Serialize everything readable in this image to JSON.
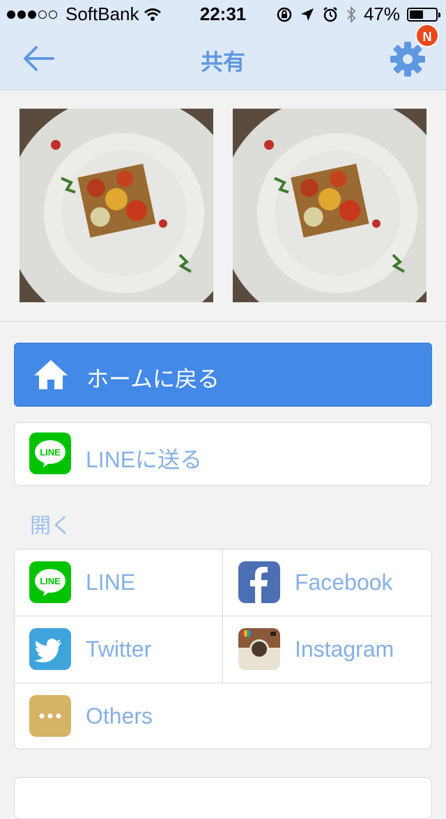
{
  "status_bar": {
    "carrier": "SoftBank",
    "time": "22:31",
    "battery": "47%",
    "battery_level": 0.47
  },
  "nav": {
    "title": "共有",
    "badge": "N",
    "icons": [
      "back-arrow-icon",
      "gear-icon"
    ]
  },
  "photos": [
    "food-plate-photo",
    "food-plate-photo"
  ],
  "home_button": {
    "label": "ホームに戻る",
    "icon": "house-icon"
  },
  "line_send": {
    "label": "LINEに送る",
    "icon_text": "LINE"
  },
  "open_section": {
    "title": "開く"
  },
  "share_grid": [
    {
      "label": "LINE",
      "icon_text": "LINE",
      "icon": "line-icon"
    },
    {
      "label": "Facebook",
      "icon": "facebook-icon"
    },
    {
      "label": "Twitter",
      "icon": "twitter-icon"
    },
    {
      "label": "Instagram",
      "icon": "instagram-icon"
    },
    {
      "label": "Others",
      "icon": "more-dots-icon"
    }
  ],
  "colors": {
    "nav_bg": "#dde9f7",
    "accent": "#4289e8",
    "label": "#85b0e6",
    "line_green": "#00c300",
    "facebook": "#4c6fb4",
    "twitter": "#3ea4db",
    "others": "#d6b466"
  }
}
